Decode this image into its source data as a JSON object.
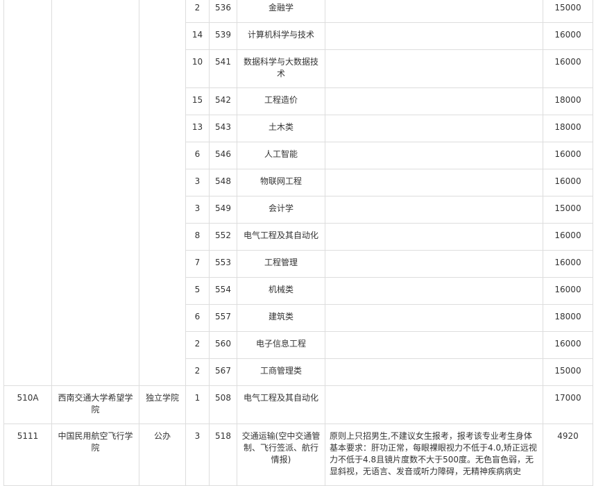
{
  "rows": [
    {
      "plan": "2",
      "code": "536",
      "major": "金融学",
      "remark": "",
      "fee": "15000"
    },
    {
      "plan": "14",
      "code": "539",
      "major": "计算机科学与技术",
      "remark": "",
      "fee": "16000"
    },
    {
      "plan": "10",
      "code": "541",
      "major": "数据科学与大数据技术",
      "remark": "",
      "fee": "16000"
    },
    {
      "plan": "15",
      "code": "542",
      "major": "工程造价",
      "remark": "",
      "fee": "18000"
    },
    {
      "plan": "13",
      "code": "543",
      "major": "土木类",
      "remark": "",
      "fee": "18000"
    },
    {
      "plan": "6",
      "code": "546",
      "major": "人工智能",
      "remark": "",
      "fee": "16000"
    },
    {
      "plan": "3",
      "code": "548",
      "major": "物联网工程",
      "remark": "",
      "fee": "16000"
    },
    {
      "plan": "3",
      "code": "549",
      "major": "会计学",
      "remark": "",
      "fee": "15000"
    },
    {
      "plan": "8",
      "code": "552",
      "major": "电气工程及其自动化",
      "remark": "",
      "fee": "16000"
    },
    {
      "plan": "7",
      "code": "553",
      "major": "工程管理",
      "remark": "",
      "fee": "16000"
    },
    {
      "plan": "5",
      "code": "554",
      "major": "机械类",
      "remark": "",
      "fee": "16000"
    },
    {
      "plan": "6",
      "code": "557",
      "major": "建筑类",
      "remark": "",
      "fee": "18000"
    },
    {
      "plan": "2",
      "code": "560",
      "major": "电子信息工程",
      "remark": "",
      "fee": "16000"
    },
    {
      "plan": "2",
      "code": "567",
      "major": "工商管理类",
      "remark": "",
      "fee": "15000"
    }
  ],
  "school_510a": {
    "id": "510A",
    "name": "西南交通大学希望学院",
    "type": "独立学院",
    "plan": "1",
    "code": "508",
    "major": "电气工程及其自动化",
    "remark": "",
    "fee": "17000"
  },
  "school_5111": {
    "id": "5111",
    "name": "中国民用航空飞行学院",
    "type": "公办",
    "plan": "3",
    "code": "518",
    "major": "交通运输(空中交通管制、飞行签派、航行情报)",
    "remark": "原则上只招男生,不建议女生报考，报考该专业考生身体基本要求：肝功正常，每眼裸眼视力不低于4.0,矫正远视力不低于4.8且镜片度数不大于500度。无色盲色弱，无显斜视，无语言、发音或听力障碍，无精神疾病病史",
    "fee": "4920"
  }
}
